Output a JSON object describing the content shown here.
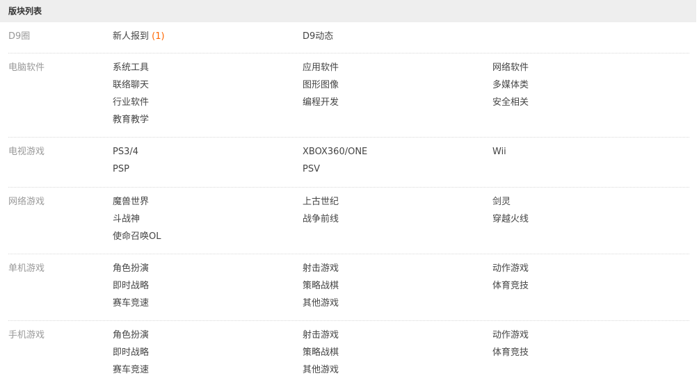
{
  "header": {
    "title": "版块列表"
  },
  "sections": [
    {
      "title": "D9圈",
      "items": [
        {
          "label": "新人报到",
          "count": "(1)"
        },
        {
          "label": "D9动态"
        }
      ]
    },
    {
      "title": "电脑软件",
      "items": [
        {
          "label": "系统工具"
        },
        {
          "label": "应用软件"
        },
        {
          "label": "网络软件"
        },
        {
          "label": "联络聊天"
        },
        {
          "label": "图形图像"
        },
        {
          "label": "多媒体类"
        },
        {
          "label": "行业软件"
        },
        {
          "label": "编程开发"
        },
        {
          "label": "安全相关"
        },
        {
          "label": "教育教学"
        }
      ]
    },
    {
      "title": "电视游戏",
      "items": [
        {
          "label": "PS3/4"
        },
        {
          "label": "XBOX360/ONE"
        },
        {
          "label": "Wii"
        },
        {
          "label": "PSP"
        },
        {
          "label": "PSV"
        }
      ]
    },
    {
      "title": "网络游戏",
      "items": [
        {
          "label": "魔兽世界"
        },
        {
          "label": "上古世纪"
        },
        {
          "label": "剑灵"
        },
        {
          "label": "斗战神"
        },
        {
          "label": "战争前线"
        },
        {
          "label": "穿越火线"
        },
        {
          "label": "使命召唤OL"
        }
      ]
    },
    {
      "title": "单机游戏",
      "items": [
        {
          "label": "角色扮演"
        },
        {
          "label": "射击游戏"
        },
        {
          "label": "动作游戏"
        },
        {
          "label": "即时战略"
        },
        {
          "label": "策略战棋"
        },
        {
          "label": "体育竞技"
        },
        {
          "label": "赛车竞速"
        },
        {
          "label": "其他游戏"
        }
      ]
    },
    {
      "title": "手机游戏",
      "items": [
        {
          "label": "角色扮演"
        },
        {
          "label": "射击游戏"
        },
        {
          "label": "动作游戏"
        },
        {
          "label": "即时战略"
        },
        {
          "label": "策略战棋"
        },
        {
          "label": "体育竞技"
        },
        {
          "label": "赛车竞速"
        },
        {
          "label": "其他游戏"
        }
      ]
    }
  ],
  "colors": {
    "header_bg": "#eeeeee",
    "section_title": "#999999",
    "link": "#444444",
    "count": "#ff6600",
    "divider": "#d8d8d8"
  }
}
